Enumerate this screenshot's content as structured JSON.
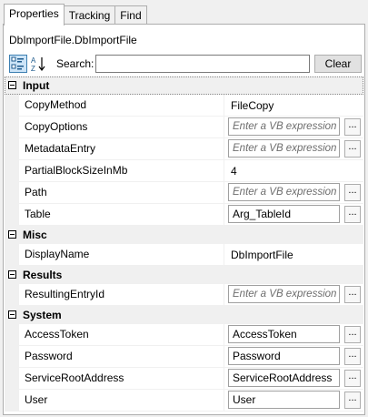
{
  "tabs": [
    {
      "label": "Properties",
      "active": true
    },
    {
      "label": "Tracking",
      "active": false
    },
    {
      "label": "Find",
      "active": false
    }
  ],
  "object_title": "DbImportFile.DbImportFile",
  "toolbar": {
    "categorized_icon": "categorized-view-icon",
    "alphabetical_icon": "sort-az-icon",
    "search_label": "Search:",
    "search_value": "",
    "clear_label": "Clear"
  },
  "groups": {
    "input": {
      "label": "Input",
      "props": [
        {
          "name": "CopyMethod",
          "value": "FileCopy"
        },
        {
          "name": "CopyOptions",
          "value": "Enter a VB expression"
        },
        {
          "name": "MetadataEntry",
          "value": "Enter a VB expression"
        },
        {
          "name": "PartialBlockSizeInMb",
          "value": "4"
        },
        {
          "name": "Path",
          "value": "Enter a VB expression"
        },
        {
          "name": "Table",
          "value": "Arg_TableId"
        }
      ]
    },
    "misc": {
      "label": "Misc",
      "props": [
        {
          "name": "DisplayName",
          "value": "DbImportFile"
        }
      ]
    },
    "results": {
      "label": "Results",
      "props": [
        {
          "name": "ResultingEntryId",
          "value": "Enter a VB expression"
        }
      ]
    },
    "system": {
      "label": "System",
      "props": [
        {
          "name": "AccessToken",
          "value": "AccessToken"
        },
        {
          "name": "Password",
          "value": "Password"
        },
        {
          "name": "ServiceRootAddress",
          "value": "ServiceRootAddress"
        },
        {
          "name": "User",
          "value": "User"
        }
      ]
    }
  },
  "ellipsis_label": "..."
}
